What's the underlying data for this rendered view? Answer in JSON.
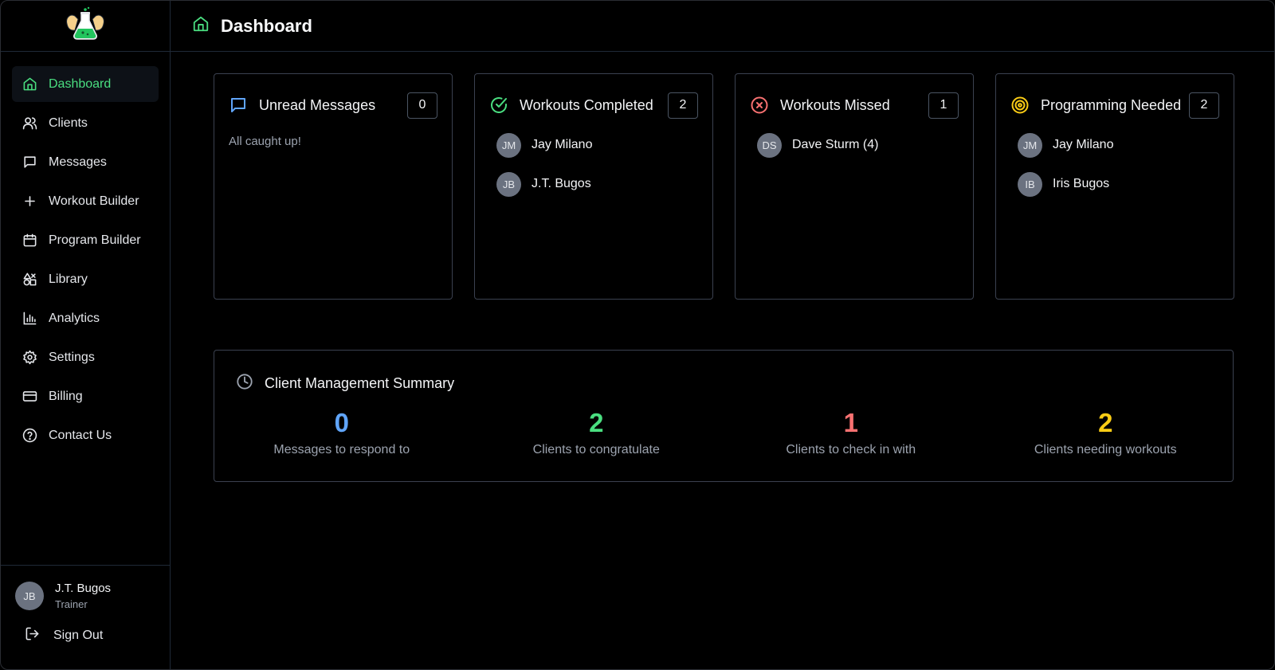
{
  "app": {
    "logo_icon": "flask-biceps-logo"
  },
  "sidebar": {
    "items": [
      {
        "label": "Dashboard",
        "icon": "home-icon",
        "active": true
      },
      {
        "label": "Clients",
        "icon": "users-icon"
      },
      {
        "label": "Messages",
        "icon": "message-icon"
      },
      {
        "label": "Workout Builder",
        "icon": "plus-icon"
      },
      {
        "label": "Program Builder",
        "icon": "calendar-icon"
      },
      {
        "label": "Library",
        "icon": "shapes-icon"
      },
      {
        "label": "Analytics",
        "icon": "bar-chart-icon"
      },
      {
        "label": "Settings",
        "icon": "gear-icon"
      },
      {
        "label": "Billing",
        "icon": "credit-card-icon"
      },
      {
        "label": "Contact Us",
        "icon": "help-circle-icon"
      }
    ],
    "user": {
      "initials": "JB",
      "name": "J.T. Bugos",
      "role": "Trainer"
    },
    "signout_label": "Sign Out"
  },
  "header": {
    "title": "Dashboard"
  },
  "cards": [
    {
      "title": "Unread Messages",
      "count": "0",
      "empty_text": "All caught up!",
      "clients": []
    },
    {
      "title": "Workouts Completed",
      "count": "2",
      "clients": [
        {
          "initials": "JM",
          "name": "Jay Milano"
        },
        {
          "initials": "JB",
          "name": "J.T. Bugos"
        }
      ]
    },
    {
      "title": "Workouts Missed",
      "count": "1",
      "clients": [
        {
          "initials": "DS",
          "name": "Dave Sturm (4)"
        }
      ]
    },
    {
      "title": "Programming Needed",
      "count": "2",
      "clients": [
        {
          "initials": "JM",
          "name": "Jay Milano"
        },
        {
          "initials": "IB",
          "name": "Iris Bugos"
        }
      ]
    }
  ],
  "summary": {
    "title": "Client Management Summary",
    "stats": [
      {
        "value": "0",
        "label": "Messages to respond to",
        "color": "#60a5fa"
      },
      {
        "value": "2",
        "label": "Clients to congratulate",
        "color": "#4ade80"
      },
      {
        "value": "1",
        "label": "Clients to check in with",
        "color": "#f87171"
      },
      {
        "value": "2",
        "label": "Clients needing workouts",
        "color": "#facc15"
      }
    ]
  },
  "colors": {
    "accent": "#4ade80",
    "blue": "#60a5fa",
    "red": "#f87171",
    "yellow": "#facc15"
  }
}
